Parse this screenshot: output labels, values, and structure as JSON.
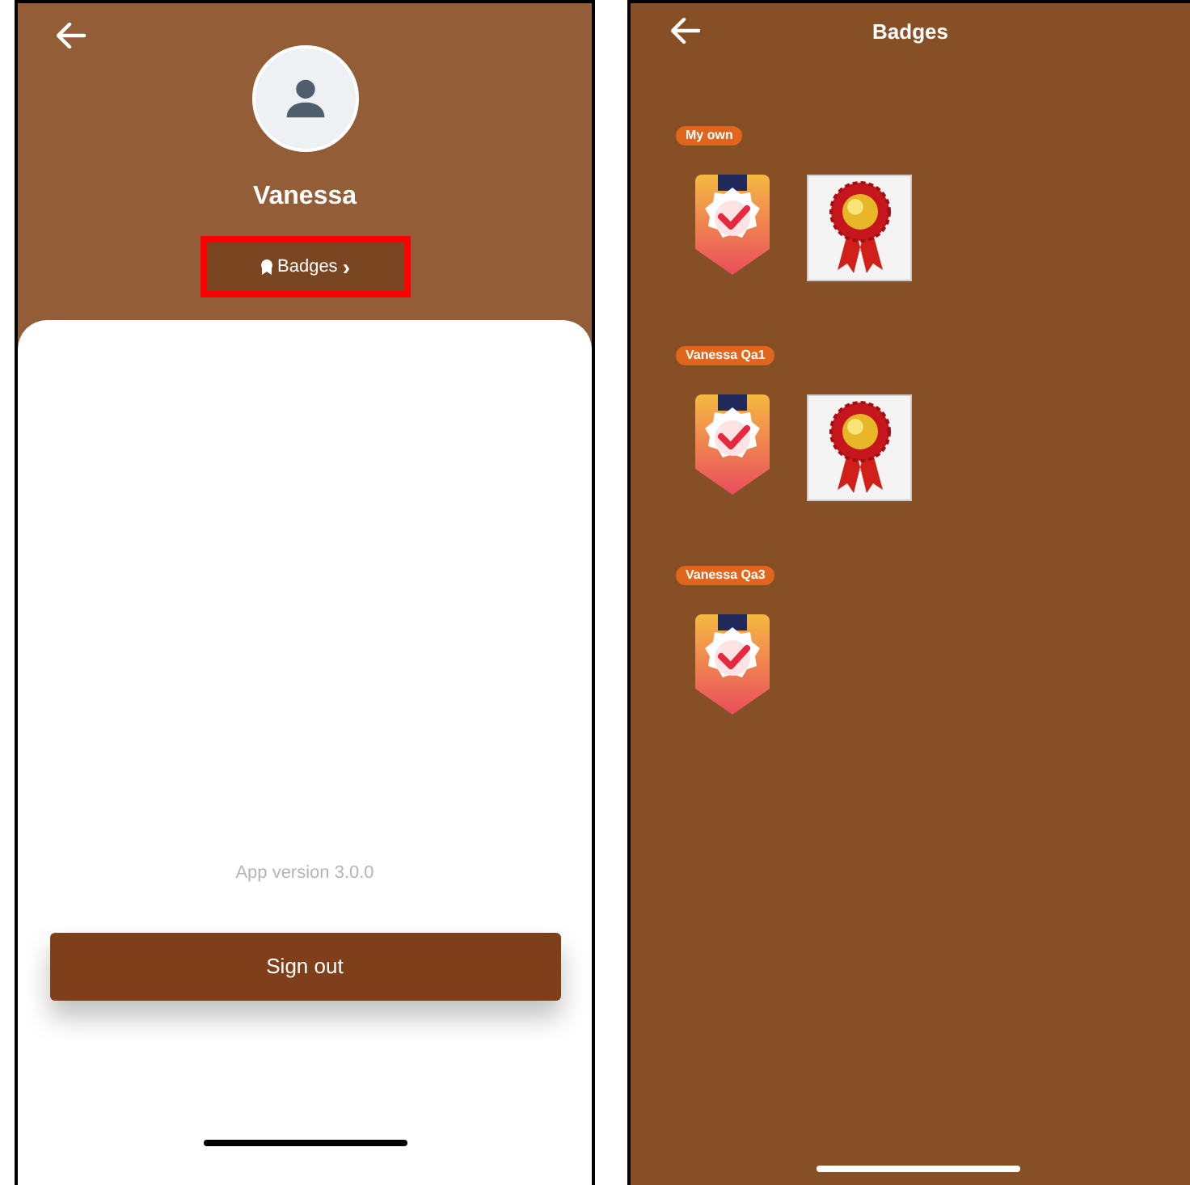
{
  "profile_screen": {
    "name": "Vanessa",
    "badges_link": {
      "label": "Badges",
      "chevron": "›",
      "highlighted": true
    },
    "app_version": "App version 3.0.0",
    "sign_out_button": "Sign out"
  },
  "badges_screen": {
    "title": "Badges",
    "groups": [
      {
        "label": "My own",
        "badges": [
          {
            "kind": "shield"
          },
          {
            "kind": "rosette"
          }
        ]
      },
      {
        "label": "Vanessa Qa1",
        "badges": [
          {
            "kind": "shield"
          },
          {
            "kind": "rosette"
          }
        ]
      },
      {
        "label": "Vanessa Qa3",
        "badges": [
          {
            "kind": "shield"
          }
        ]
      }
    ]
  }
}
